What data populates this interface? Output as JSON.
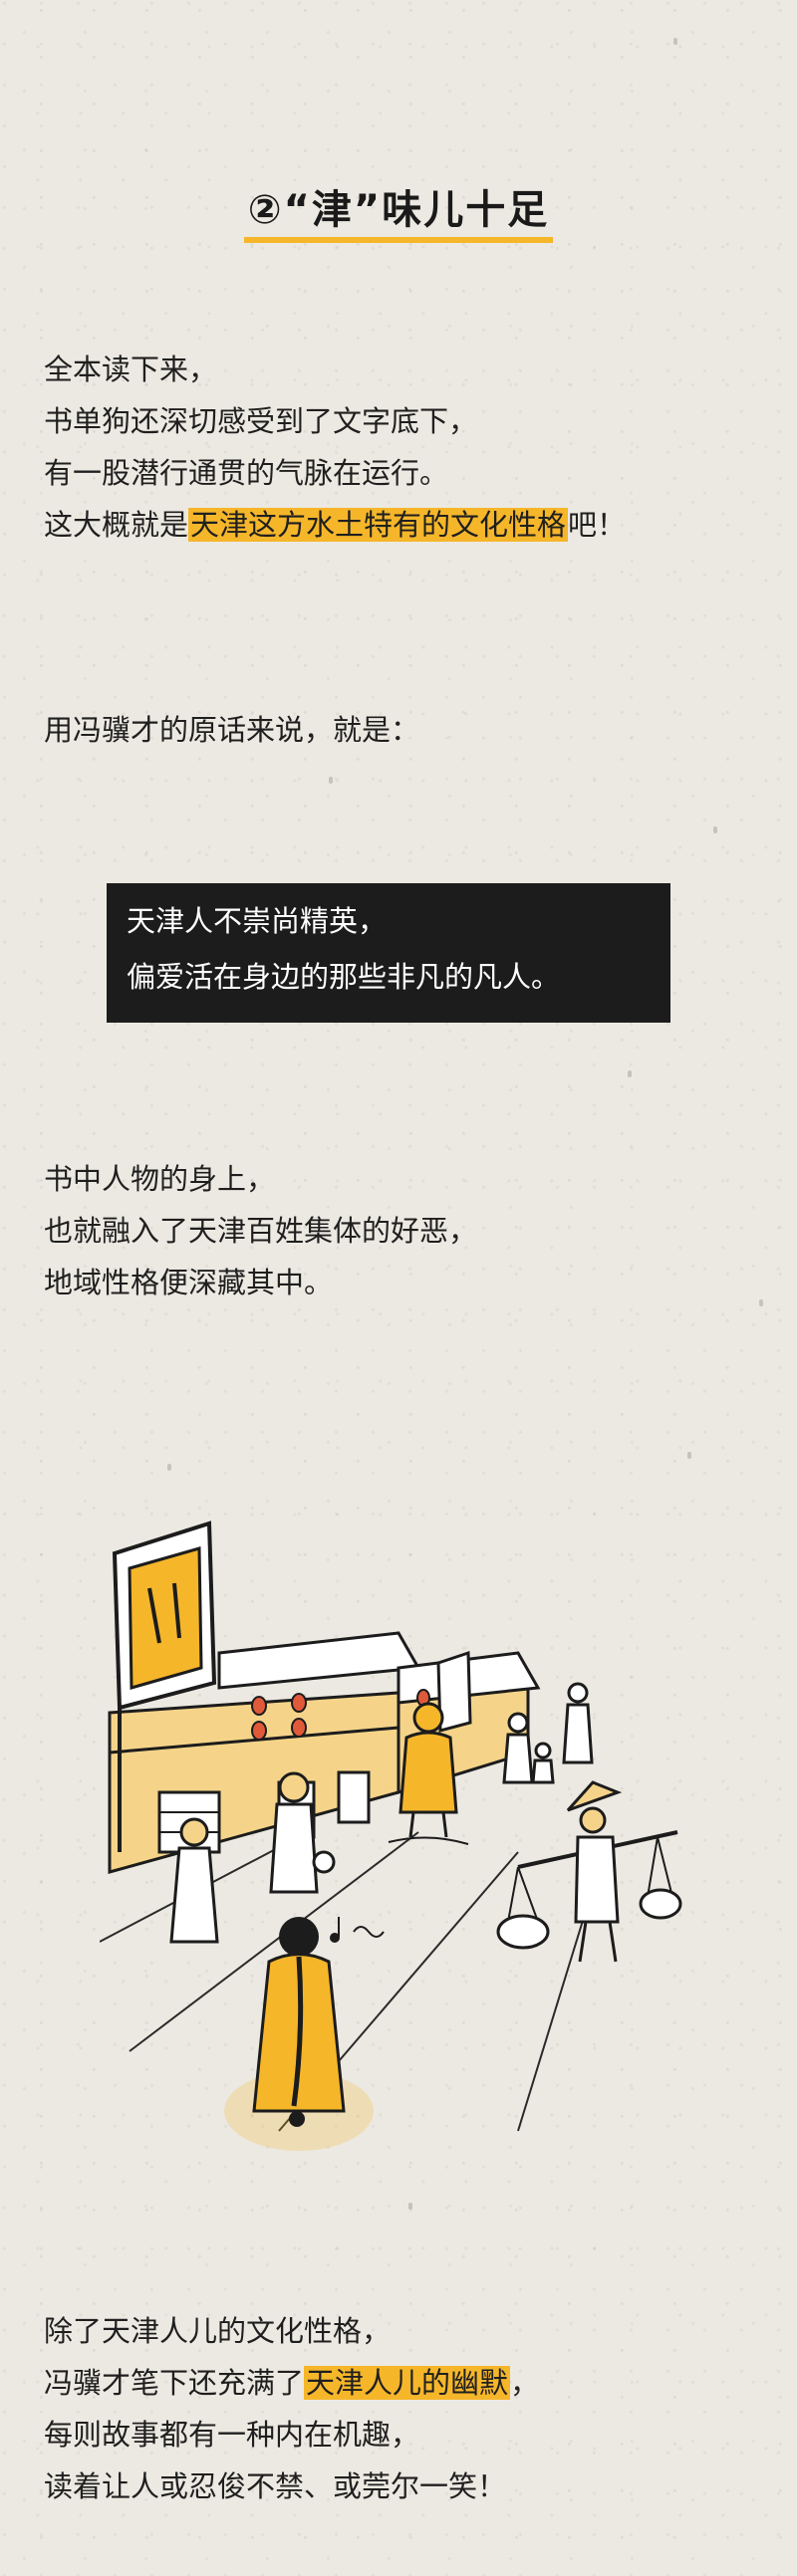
{
  "section_title": "②“津”味儿十足",
  "intro": {
    "lines": [
      "全本读下来，",
      "书单狗还深切感受到了文字底下，",
      "有一股潜行通贯的气脉在运行。"
    ],
    "line4_prefix": "这大概就是",
    "line4_highlight": "天津这方水土特有的文化性格",
    "line4_suffix": "吧！"
  },
  "quote_intro": "用冯骥才的原话来说，就是：",
  "quote": {
    "line1": "天津人不崇尚精英，",
    "line2": "偏爱活在身边的那些非凡的凡人。"
  },
  "para2": {
    "lines": [
      "书中人物的身上，",
      "也就融入了天津百姓集体的好恶，",
      "地域性格便深藏其中。"
    ]
  },
  "illustration": {
    "icon": "old-tianjin-street-illustration",
    "colors": {
      "accent": "#f5b62a",
      "ink": "#1c1c1c",
      "paper": "#ece9e2"
    }
  },
  "para3": {
    "line1": "除了天津人儿的文化性格，",
    "line2_prefix": "冯骥才笔下还充满了",
    "line2_highlight": "天津人儿的幽默",
    "line2_suffix": "，",
    "line3": "每则故事都有一种内在机趣，",
    "line4": "读着让人或忍俊不禁、或莞尔一笑！"
  }
}
